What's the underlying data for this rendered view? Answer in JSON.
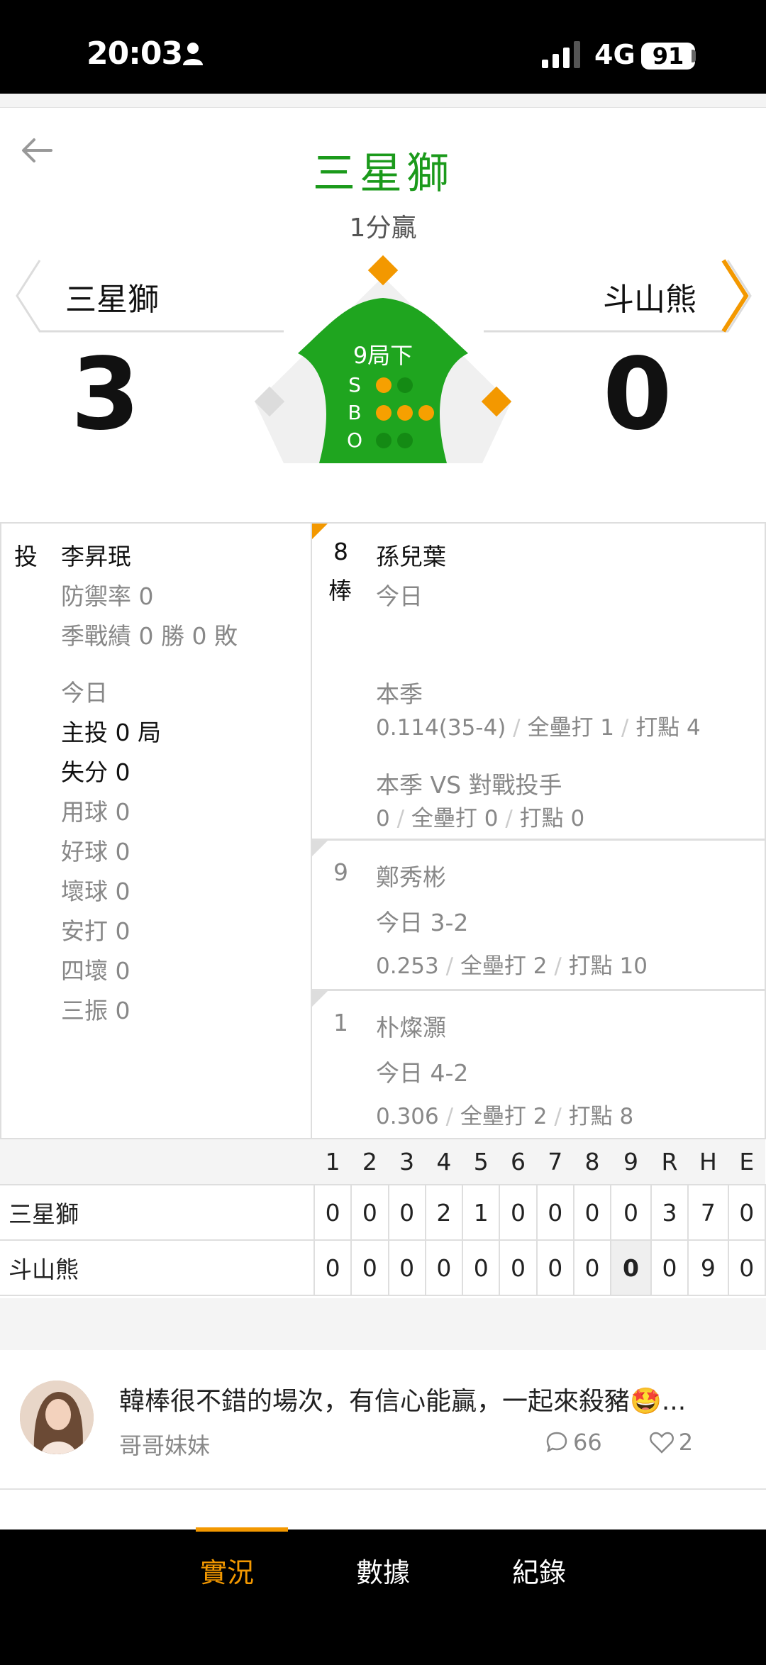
{
  "status_bar": {
    "time": "20:03",
    "network": "4G",
    "battery": "91"
  },
  "header": {
    "title": "三星獅",
    "subtitle": "1分贏"
  },
  "home": {
    "name": "三星獅",
    "score": "3"
  },
  "away": {
    "name": "斗山熊",
    "score": "0"
  },
  "situation": {
    "inning": "9局下",
    "labels": [
      "S",
      "B",
      "O"
    ],
    "strikes": 1,
    "balls": 3,
    "outs": 0,
    "bases": {
      "first": true,
      "second": true,
      "third": false
    }
  },
  "pitcher": {
    "role": "投",
    "name": "李昇珉",
    "era": "防禦率 0",
    "record": "季戰績 0 勝 0 敗",
    "today_label": "今日",
    "innings": "主投 0 局",
    "runs": "失分 0",
    "stats": [
      "用球 0",
      "好球 0",
      "壞球 0",
      "安打 0",
      "四壞 0",
      "三振 0"
    ]
  },
  "batters": [
    {
      "order": "8",
      "order_suffix": "棒",
      "name": "孫兒葉",
      "today": "今日",
      "season_label": "本季",
      "season": [
        "0.114(35-4)",
        "全壘打 1",
        "打點 4"
      ],
      "vs_label": "本季 VS 對戰投手",
      "vs": [
        "0",
        "全壘打 0",
        "打點 0"
      ]
    },
    {
      "order": "9",
      "name": "鄭秀彬",
      "today": "今日 3-2",
      "season": [
        "0.253",
        "全壘打 2",
        "打點 10"
      ]
    },
    {
      "order": "1",
      "name": "朴燦灝",
      "today": "今日 4-2",
      "season": [
        "0.306",
        "全壘打 2",
        "打點 8"
      ]
    }
  ],
  "scoreboard": {
    "headers": [
      "1",
      "2",
      "3",
      "4",
      "5",
      "6",
      "7",
      "8",
      "9",
      "R",
      "H",
      "E"
    ],
    "rows": [
      {
        "team": "三星獅",
        "cells": [
          "0",
          "0",
          "0",
          "2",
          "1",
          "0",
          "0",
          "0",
          "0",
          "3",
          "7",
          "0"
        ]
      },
      {
        "team": "斗山熊",
        "cells": [
          "0",
          "0",
          "0",
          "0",
          "0",
          "0",
          "0",
          "0",
          "0",
          "0",
          "9",
          "0"
        ]
      }
    ]
  },
  "comment": {
    "text": "韓棒很不錯的場次，有信心能贏，一起來殺豬🤩...",
    "user": "哥哥妹妹",
    "replies": "66",
    "likes": "2"
  },
  "nav": {
    "items": [
      "實況",
      "數據",
      "紀錄"
    ],
    "active": 0
  },
  "colors": {
    "accent": "#f39800",
    "field": "#1fa51f",
    "title": "#1b9a1b"
  }
}
